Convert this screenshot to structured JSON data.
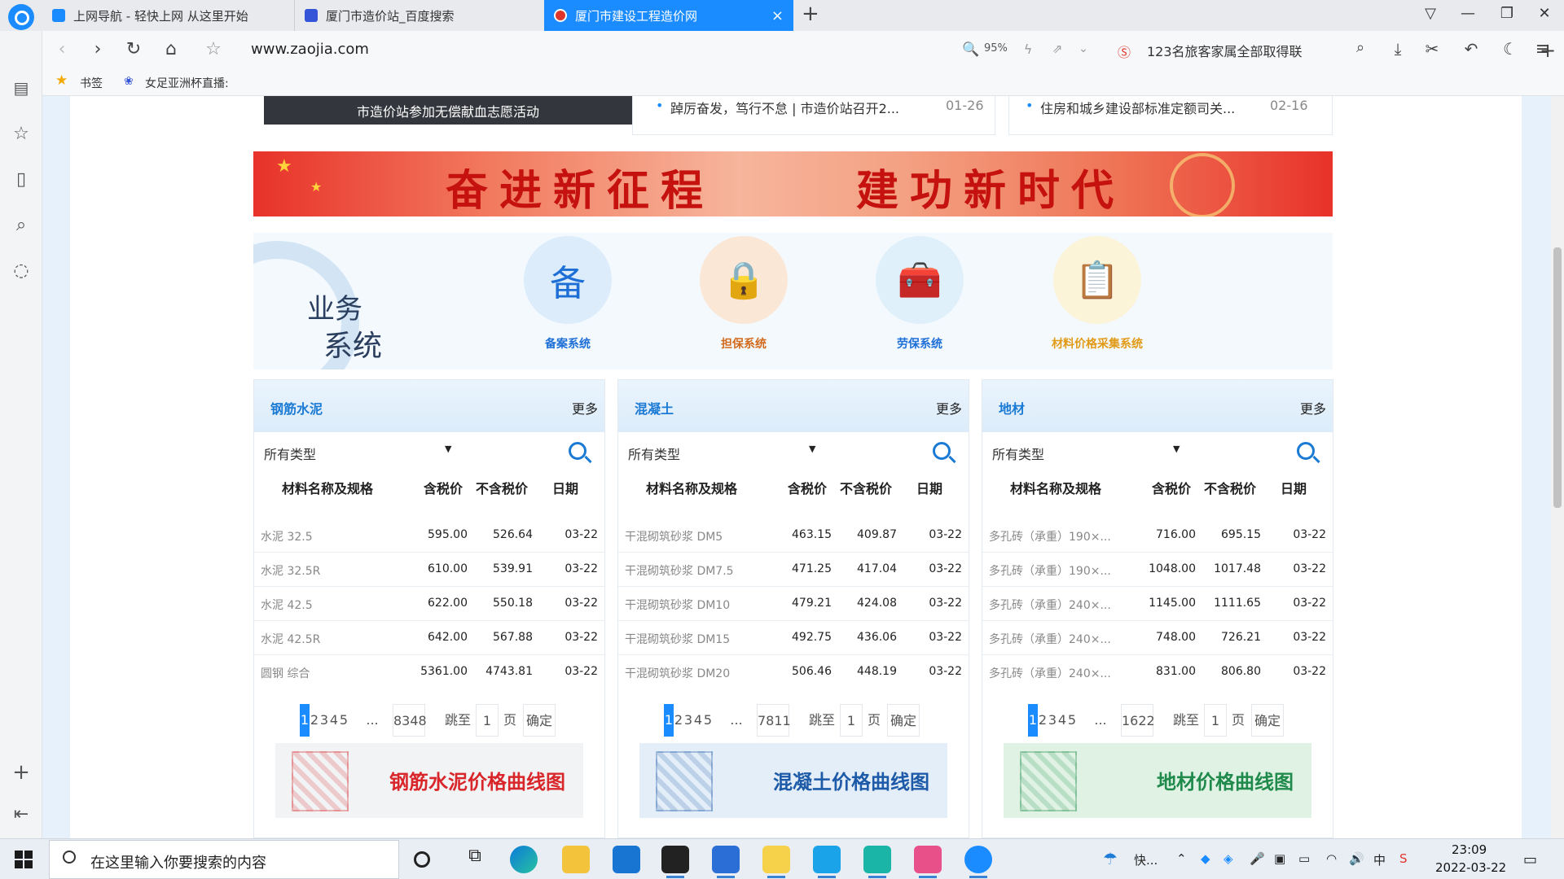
{
  "tabs": [
    {
      "title": "上网导航 - 轻快上网 从这里开始",
      "color": "#1a8cff"
    },
    {
      "title": "厦门市造价站_百度搜索",
      "color": "#3555d8"
    },
    {
      "title": "厦门市建设工程造价网",
      "color": "#e0352b",
      "close": "×"
    }
  ],
  "nav": {
    "url": "www.zaojia.com",
    "zoom": "95%",
    "search_text": "123名旅客家属全部取得联"
  },
  "bookmarks": [
    {
      "label": "书签"
    },
    {
      "label": "女足亚洲杯直播:"
    }
  ],
  "news": {
    "photo_caption": "市造价站参加无偿献血志愿活动",
    "left": {
      "text": "踔厉奋发，笃行不怠 | 市造价站召开2...",
      "date": "01-26"
    },
    "right": {
      "text": "住房和城乡建设部标准定额司关...",
      "date": "02-16"
    }
  },
  "banner": {
    "left": "奋进新征程",
    "right": "建功新时代"
  },
  "business": {
    "title_line1": "业务",
    "title_line2": "系统",
    "items": [
      {
        "label": "备案系统",
        "glyph": "备",
        "color": "#1d6fd6",
        "bg": "#dcecfb"
      },
      {
        "label": "担保系统",
        "glyph": "🔒",
        "color": "#d26a1c",
        "bg": "#fbe7d6"
      },
      {
        "label": "劳保系统",
        "glyph": "🧰",
        "color": "#1d6fd6",
        "bg": "#dff0fb"
      },
      {
        "label": "材料价格采集系统",
        "glyph": "📋",
        "color": "#e19a16",
        "bg": "#fbf4d9"
      }
    ]
  },
  "panels": [
    {
      "title": "钢筋水泥",
      "more": "更多",
      "filter": "所有类型",
      "headers": [
        "材料名称及规格",
        "含税价",
        "不含税价",
        "日期"
      ],
      "rows": [
        [
          "水泥 32.5",
          "595.00",
          "526.64",
          "03-22"
        ],
        [
          "水泥 32.5R",
          "610.00",
          "539.91",
          "03-22"
        ],
        [
          "水泥 42.5",
          "622.00",
          "550.18",
          "03-22"
        ],
        [
          "水泥 42.5R",
          "642.00",
          "567.88",
          "03-22"
        ],
        [
          "圆钢 综合",
          "5361.00",
          "4743.81",
          "03-22"
        ]
      ],
      "pages": [
        "1",
        "2",
        "3",
        "4",
        "5",
        "...",
        "8348"
      ],
      "jump_label": "跳至",
      "jump_value": "1",
      "page_label": "页",
      "confirm": "确定",
      "chart_link": "钢筋水泥价格曲线图",
      "chart_color": "#d9262a",
      "chart_bg": "#f1f3f5"
    },
    {
      "title": "混凝土",
      "more": "更多",
      "filter": "所有类型",
      "headers": [
        "材料名称及规格",
        "含税价",
        "不含税价",
        "日期"
      ],
      "rows": [
        [
          "干混砌筑砂浆 DM5",
          "463.15",
          "409.87",
          "03-22"
        ],
        [
          "干混砌筑砂浆 DM7.5",
          "471.25",
          "417.04",
          "03-22"
        ],
        [
          "干混砌筑砂浆 DM10",
          "479.21",
          "424.08",
          "03-22"
        ],
        [
          "干混砌筑砂浆 DM15",
          "492.75",
          "436.06",
          "03-22"
        ],
        [
          "干混砌筑砂浆 DM20",
          "506.46",
          "448.19",
          "03-22"
        ]
      ],
      "pages": [
        "1",
        "2",
        "3",
        "4",
        "5",
        "...",
        "7811"
      ],
      "jump_label": "跳至",
      "jump_value": "1",
      "page_label": "页",
      "confirm": "确定",
      "chart_link": "混凝土价格曲线图",
      "chart_color": "#1d5aa8",
      "chart_bg": "#e4eef8"
    },
    {
      "title": "地材",
      "more": "更多",
      "filter": "所有类型",
      "headers": [
        "材料名称及规格",
        "含税价",
        "不含税价",
        "日期"
      ],
      "rows": [
        [
          "多孔砖（承重）190×...",
          "716.00",
          "695.15",
          "03-22"
        ],
        [
          "多孔砖（承重）190×...",
          "1048.00",
          "1017.48",
          "03-22"
        ],
        [
          "多孔砖（承重）240×...",
          "1145.00",
          "1111.65",
          "03-22"
        ],
        [
          "多孔砖（承重）240×...",
          "748.00",
          "726.21",
          "03-22"
        ],
        [
          "多孔砖（承重）240×...",
          "831.00",
          "806.80",
          "03-22"
        ]
      ],
      "pages": [
        "1",
        "2",
        "3",
        "4",
        "5",
        "...",
        "1622"
      ],
      "jump_label": "跳至",
      "jump_value": "1",
      "page_label": "页",
      "confirm": "确定",
      "chart_link": "地材价格曲线图",
      "chart_color": "#1f8a4c",
      "chart_bg": "#dff2e3"
    }
  ],
  "taskbar": {
    "search_placeholder": "在这里输入你要搜索的内容",
    "weather": "快...",
    "tray_lang": "中",
    "time": "23:09",
    "date": "2022-03-22"
  }
}
